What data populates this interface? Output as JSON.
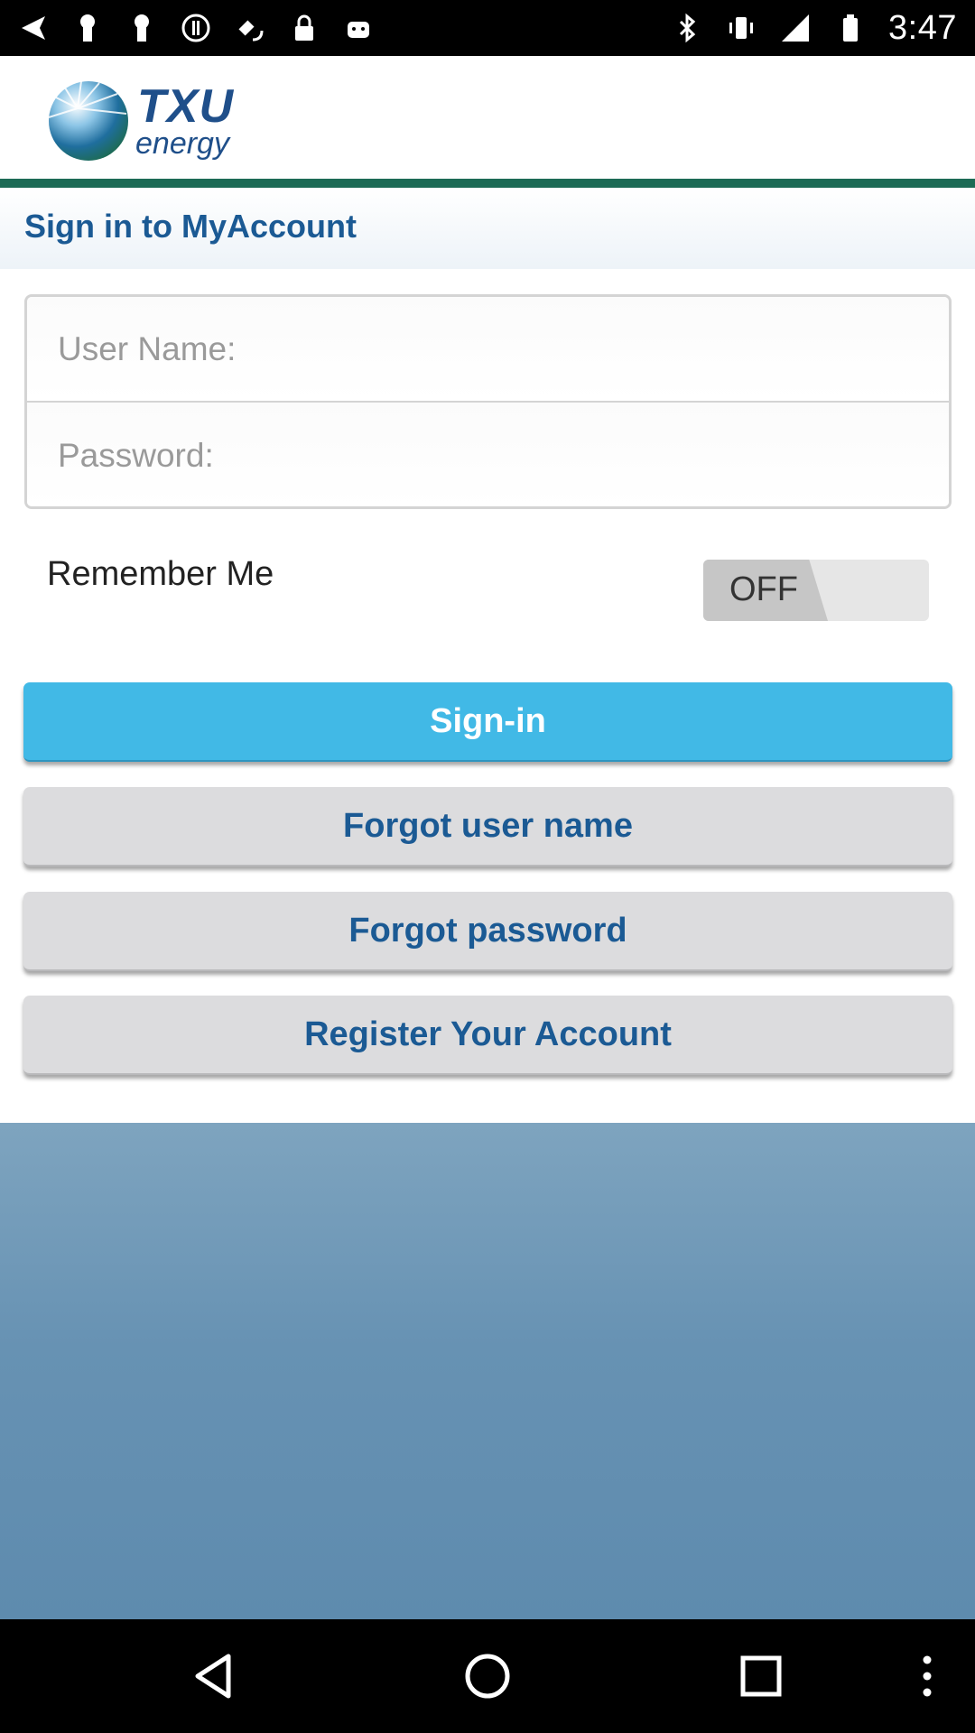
{
  "status_bar": {
    "time": "3:47",
    "left_icons": [
      "back-arrow-icon",
      "keyhole-icon",
      "keyhole-icon",
      "alert-icon",
      "fake-gps-icon",
      "lock-icon",
      "android-icon"
    ],
    "right_icons": [
      "bluetooth-icon",
      "vibrate-icon",
      "signal-icon",
      "battery-icon"
    ]
  },
  "header": {
    "logo_brand": "TXU",
    "logo_sub": "energy",
    "accent_color": "#1d6b55"
  },
  "page": {
    "title": "Sign in to MyAccount"
  },
  "form": {
    "username_placeholder": "User Name:",
    "username_value": "",
    "password_placeholder": "Password:",
    "password_value": "",
    "remember_label": "Remember Me",
    "remember_toggle": "OFF"
  },
  "buttons": {
    "sign_in": "Sign-in",
    "forgot_user": "Forgot user name",
    "forgot_password": "Forgot password",
    "register": "Register Your Account"
  },
  "colors": {
    "primary_button": "#41b9e6",
    "secondary_button": "#dcdcde",
    "title_text": "#1b5a94"
  },
  "nav_bar": {
    "icons": [
      "back-icon",
      "home-icon",
      "recents-icon",
      "menu-icon"
    ]
  }
}
